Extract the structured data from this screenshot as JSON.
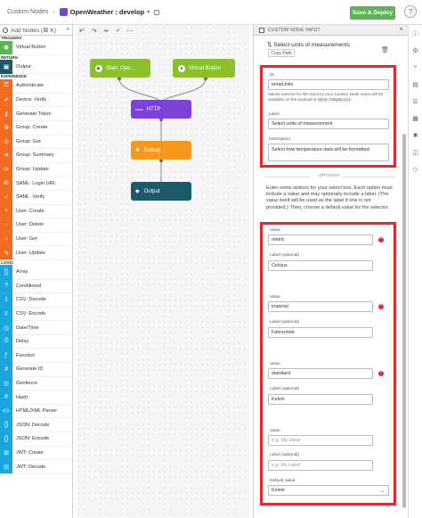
{
  "header": {
    "breadcrumb": "Custom Nodes",
    "separator": "›",
    "app_name": "OpenWeather : develop",
    "save_label": "Save & Deploy",
    "help": "?"
  },
  "palette": {
    "search_placeholder": "Add Nodes (⌘ K)",
    "collapse_label": "«",
    "sections": [
      {
        "title": "TRIGGERS",
        "items": [
          {
            "label": "Virtual Button",
            "color": "#5ab552"
          }
        ]
      },
      {
        "title": "RETURN",
        "items": [
          {
            "label": "Output",
            "color": "#1c5a6b"
          }
        ]
      },
      {
        "title": "EXPERIENCE",
        "items": [
          {
            "label": "Authenticate",
            "color": "#f26b1f"
          },
          {
            "label": "Device: Verify",
            "color": "#f26b1f"
          },
          {
            "label": "Generate Token",
            "color": "#f26b1f"
          },
          {
            "label": "Group: Create",
            "color": "#f26b1f"
          },
          {
            "label": "Group: Get",
            "color": "#f26b1f"
          },
          {
            "label": "Group: Summary",
            "color": "#f26b1f"
          },
          {
            "label": "Group: Update",
            "color": "#f26b1f"
          },
          {
            "label": "SAML: Login URL",
            "color": "#f26b1f"
          },
          {
            "label": "SAML: Verify",
            "color": "#f26b1f"
          },
          {
            "label": "User: Create",
            "color": "#f26b1f"
          },
          {
            "label": "User: Delete",
            "color": "#f26b1f"
          },
          {
            "label": "User: Get",
            "color": "#f26b1f"
          },
          {
            "label": "User: Update",
            "color": "#f26b1f"
          }
        ]
      },
      {
        "title": "LOGIC",
        "items": [
          {
            "label": "Array",
            "color": "#1aa7e0"
          },
          {
            "label": "Conditional",
            "color": "#1aa7e0"
          },
          {
            "label": "CSV: Decode",
            "color": "#1aa7e0"
          },
          {
            "label": "CSV: Encode",
            "color": "#1aa7e0"
          },
          {
            "label": "Date/Time",
            "color": "#1aa7e0"
          },
          {
            "label": "Delay",
            "color": "#1aa7e0"
          },
          {
            "label": "Function",
            "color": "#1aa7e0"
          },
          {
            "label": "Generate ID",
            "color": "#1aa7e0"
          },
          {
            "label": "Geofence",
            "color": "#1aa7e0"
          },
          {
            "label": "Hash",
            "color": "#1aa7e0"
          },
          {
            "label": "HTML/XML Parser",
            "color": "#1aa7e0"
          },
          {
            "label": "JSON: Decode",
            "color": "#1aa7e0"
          },
          {
            "label": "JSON: Encode",
            "color": "#1aa7e0"
          },
          {
            "label": "JWT: Create",
            "color": "#1aa7e0"
          },
          {
            "label": "JWT: Decode",
            "color": "#1aa7e0"
          }
        ]
      }
    ]
  },
  "canvas": {
    "nodes": {
      "start": "Start: Ope...",
      "virtual_button": "Virtual Button",
      "http": "HTTP",
      "debug": "Debug",
      "output": "Output"
    },
    "colors": {
      "start": "#8bbf2e",
      "virtual_button": "#8bbf2e",
      "http": "#7b42d9",
      "debug": "#f7981d",
      "output": "#1c5a6b"
    }
  },
  "panel": {
    "header": "CUSTOM NODE INPUT",
    "node_title": "Select units of measurements",
    "copy_path": "Copy Path",
    "id_label": "ID",
    "id_value": "tempUnits",
    "id_help": "Values entered for this input by your Custom Node users will be available on the payload at",
    "id_help_code": "data.tempUnits",
    "label_label": "Label",
    "label_value": "Select units of measurement",
    "description_label": "Description",
    "description_value": "Select how temperature data will be formatted.",
    "options_heading": "OPTIONS",
    "options_help": "Enter some options for your select box. Each option must include a value and may optionally include a label. (The value itself will be used as the label if one is not provided.) Then, choose a default value for the selector.",
    "value_label": "Value",
    "optional_label_label": "Label (optional)",
    "options": [
      {
        "value": "metric",
        "label": "Celsius"
      },
      {
        "value": "imperial",
        "label": "Fahrenheit"
      },
      {
        "value": "standard",
        "label": "Kelvin"
      }
    ],
    "new_value_placeholder": "e.g. My Value",
    "new_label_placeholder": "e.g. My Label",
    "default_value_label": "Default Value",
    "default_value": "Kelvin"
  },
  "accent": "#e8262b"
}
